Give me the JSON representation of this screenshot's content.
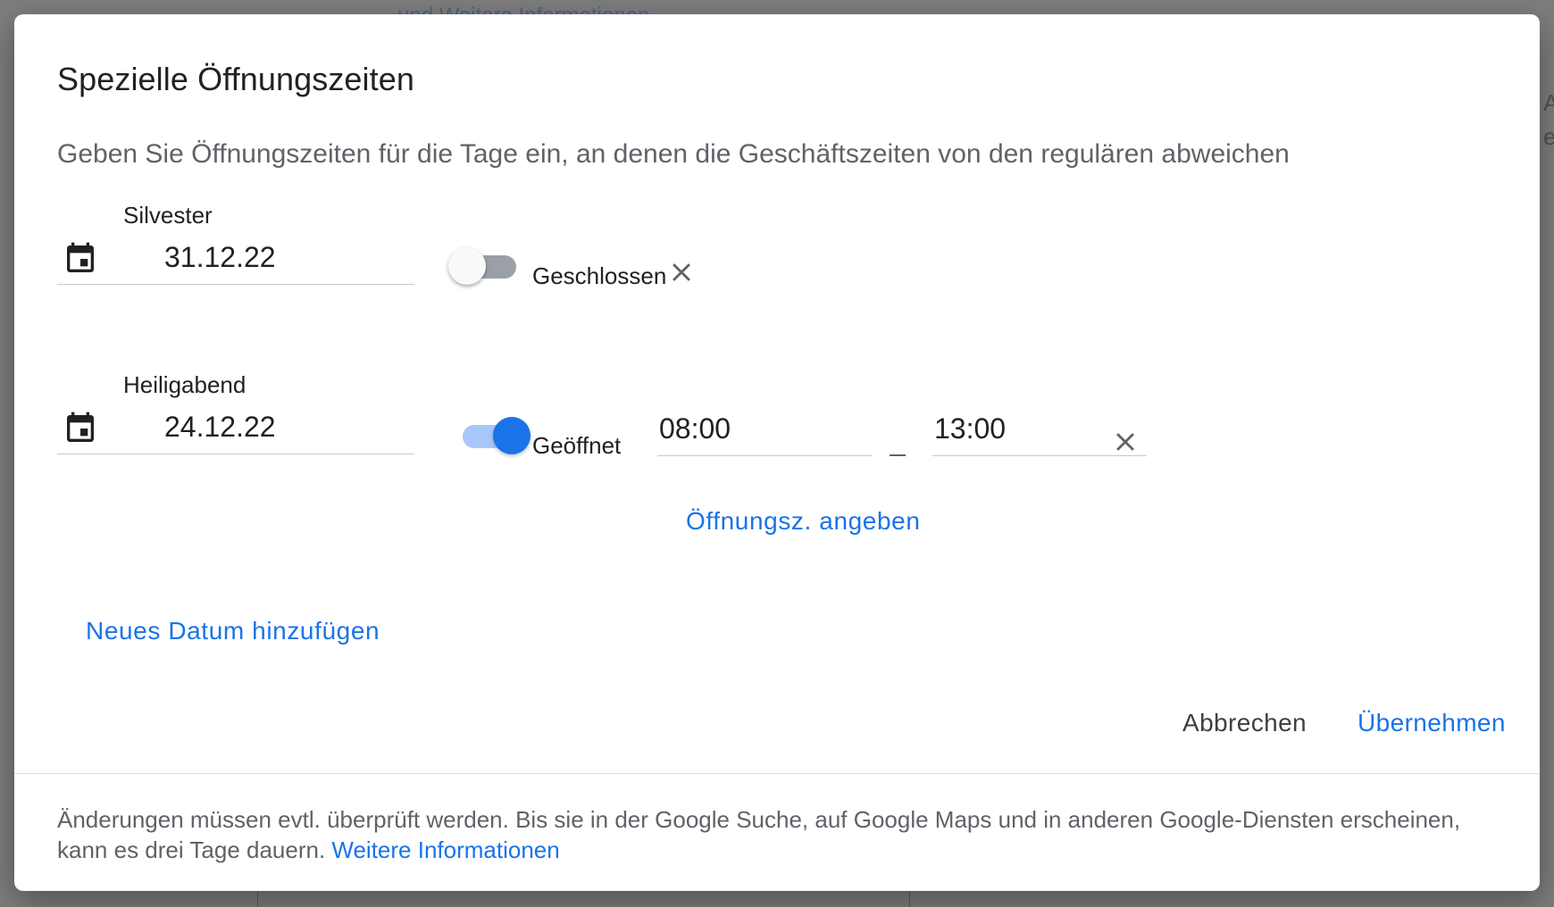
{
  "background": {
    "top_link": "und Weitere Informationen",
    "right_char_1": "A",
    "right_char_2": "e"
  },
  "dialog": {
    "title": "Spezielle Öffnungszeiten",
    "subtitle": "Geben Sie Öffnungszeiten für die Tage ein, an denen die Geschäftszeiten von den regulären abweichen"
  },
  "entries": [
    {
      "label": "Silvester",
      "date": "31.12.22",
      "toggle_on": false,
      "state_label": "Geschlossen"
    },
    {
      "label": "Heiligabend",
      "date": "24.12.22",
      "toggle_on": true,
      "state_label": "Geöffnet",
      "open_time": "08:00",
      "close_time": "13:00",
      "add_hours_link": "Öffnungsz. angeben"
    }
  ],
  "add_date_link": "Neues Datum hinzufügen",
  "actions": {
    "cancel": "Abbrechen",
    "apply": "Übernehmen"
  },
  "footer": {
    "text": "Änderungen müssen evtl. überprüft werden. Bis sie in der Google Suche, auf Google Maps und in anderen Google-Diensten erscheinen, kann es drei Tage dauern. ",
    "link": "Weitere Informationen"
  },
  "colors": {
    "accent": "#1a73e8",
    "toggle_on_track": "#a8c7fa",
    "toggle_off_track": "#9aa0a6",
    "text_primary": "#202124",
    "text_secondary": "#5f6368",
    "scrim": "#7d7d7d"
  },
  "icons": {
    "date_picker": "calendar-icon",
    "remove": "close-icon"
  }
}
